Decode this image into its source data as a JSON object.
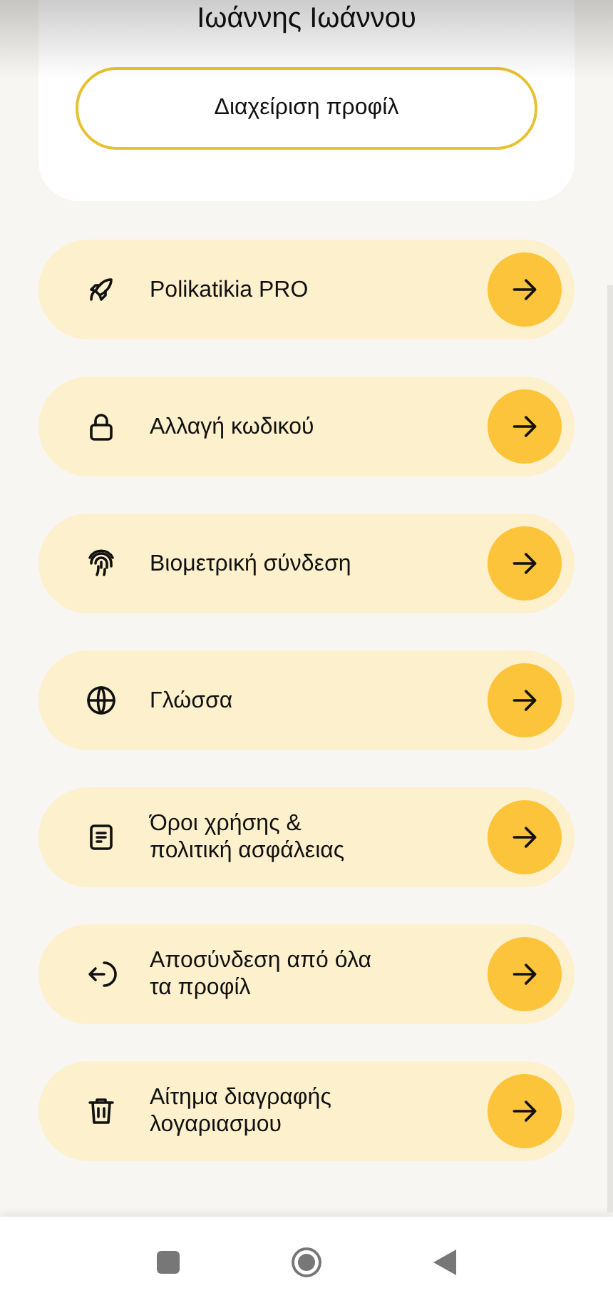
{
  "profile": {
    "name": "Ιωάννης Ιωάννου",
    "manage_button": "Διαχείριση προφίλ"
  },
  "menu": [
    {
      "label": "Polikatikia PRO"
    },
    {
      "label": "Αλλαγή κωδικού"
    },
    {
      "label": "Βιομετρική σύνδεση"
    },
    {
      "label": "Γλώσσα"
    },
    {
      "label": "Όροι χρήσης & πολιτική ασφάλειας"
    },
    {
      "label": "Αποσύνδεση από όλα τα προφίλ"
    },
    {
      "label": "Αίτημα διαγραφής λογαριασμου"
    }
  ]
}
